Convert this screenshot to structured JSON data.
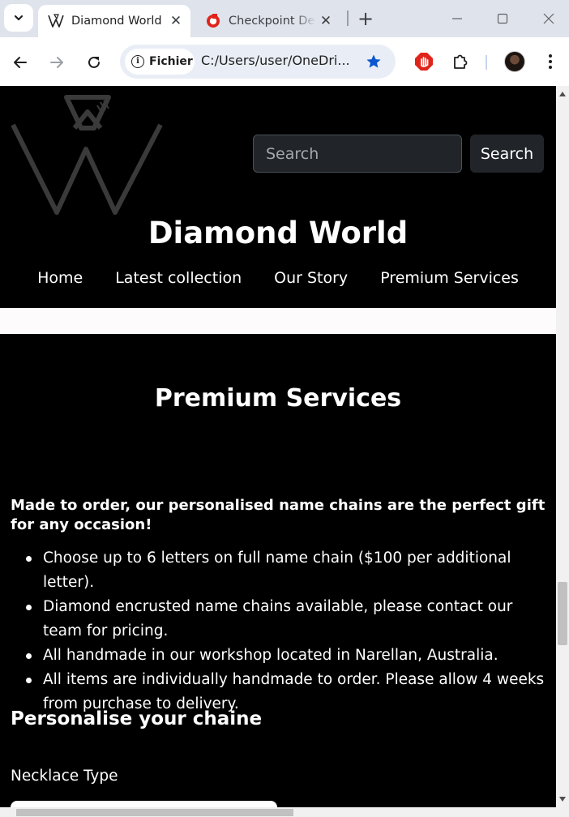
{
  "browser": {
    "tabs": [
      {
        "title": "Diamond World",
        "active": true,
        "favicon": "diamond-world-logo-icon"
      },
      {
        "title": "Checkpoint Det",
        "active": false,
        "favicon": "checkpoint-icon"
      }
    ],
    "address": {
      "chip_label": "Fichier",
      "url": "C:/Users/user/OneDri..."
    },
    "accent": "#0b57d0"
  },
  "header": {
    "search_placeholder": "Search",
    "search_button": "Search",
    "brand": "Diamond World",
    "nav": [
      "Home",
      "Latest collection",
      "Our Story",
      "Premium Services"
    ]
  },
  "main": {
    "section_title": "Premium Services",
    "lead": "Made to order, our personalised name chains are the perfect gift for any occasion!",
    "bullets": [
      "Choose up to 6 letters on full name chain ($100 per additional letter).",
      "Diamond encrusted name chains available, please contact our team for pricing.",
      "All handmade in our workshop located in Narellan, Australia.",
      "All items are individually handmade to order. Please allow 4 weeks from purchase to delivery."
    ],
    "subsection_title": "Personalise your chaine",
    "field_label": "Necklace Type"
  }
}
